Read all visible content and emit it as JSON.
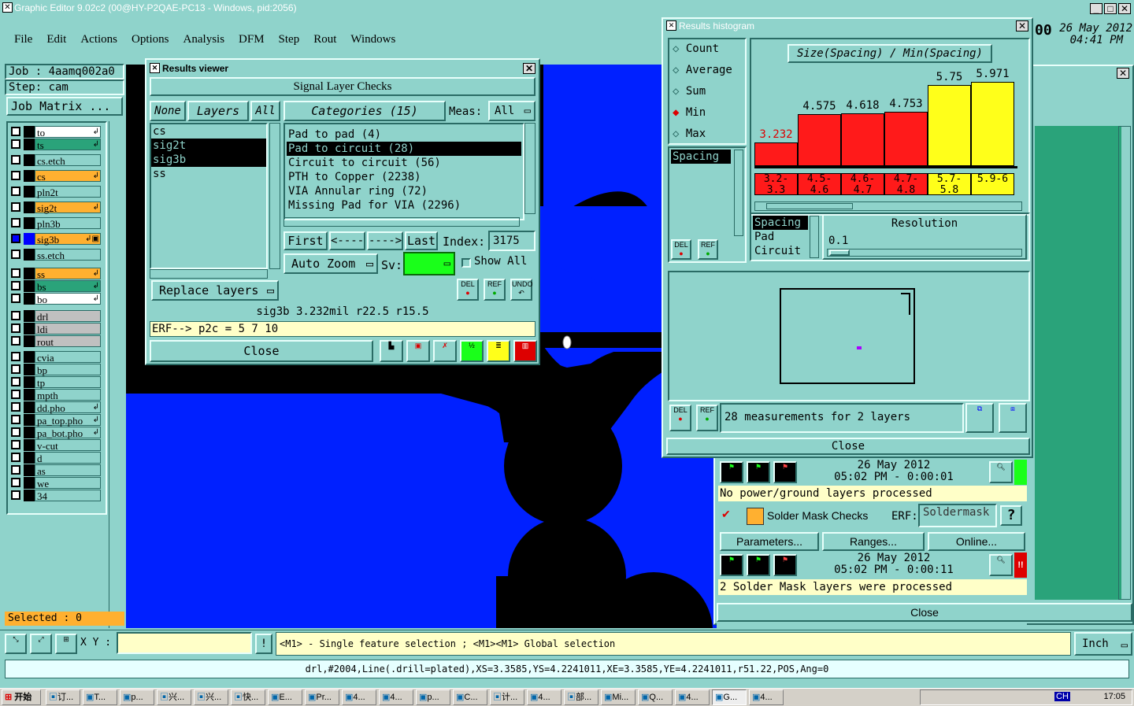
{
  "app": {
    "title": "Graphic Editor 9.02c2 (00@HY-P2QAE-PC13 - Windows, pid:2056)",
    "date": "26 May 2012",
    "time": "04:41 PM",
    "clock_prefix": "00"
  },
  "menu": [
    "File",
    "Edit",
    "Actions",
    "Options",
    "Analysis",
    "DFM",
    "Step",
    "Rout",
    "Windows"
  ],
  "job": {
    "label": "Job : 4aamq002a0",
    "step": "Step: cam",
    "matrix_button": "Job Matrix ..."
  },
  "layers": [
    {
      "name": "to",
      "color": "#ffffff",
      "sym": "↲"
    },
    {
      "name": "ts",
      "color": "#2aa37a",
      "sym": "↲"
    },
    {
      "name": "cs.etch",
      "color": "#8fd3cb",
      "sym": ""
    },
    {
      "name": "cs",
      "color": "#ffb030",
      "sym": "↲"
    },
    {
      "name": "pln2t",
      "color": "#8fd3cb",
      "sym": ""
    },
    {
      "name": "sig2t",
      "color": "#ffb030",
      "sym": "↲"
    },
    {
      "name": "pln3b",
      "color": "#8fd3cb",
      "sym": ""
    },
    {
      "name": "sig3b",
      "color": "#ffb030",
      "sym": "↲▣"
    },
    {
      "name": "ss.etch",
      "color": "#8fd3cb",
      "sym": ""
    },
    {
      "name": "ss",
      "color": "#ffb030",
      "sym": "↲"
    },
    {
      "name": "bs",
      "color": "#2aa37a",
      "sym": "↲"
    },
    {
      "name": "bo",
      "color": "#ffffff",
      "sym": "↲"
    },
    {
      "name": "drl",
      "color": "#c0c0c0",
      "sym": ""
    },
    {
      "name": "ldi",
      "color": "#c0c0c0",
      "sym": ""
    },
    {
      "name": "rout",
      "color": "#c0c0c0",
      "sym": ""
    },
    {
      "name": "cvia",
      "color": "#8fd3cb",
      "sym": ""
    },
    {
      "name": "bp",
      "color": "#8fd3cb",
      "sym": ""
    },
    {
      "name": "tp",
      "color": "#8fd3cb",
      "sym": ""
    },
    {
      "name": "mpth",
      "color": "#8fd3cb",
      "sym": ""
    },
    {
      "name": "dd.pho",
      "color": "#8fd3cb",
      "sym": "↲"
    },
    {
      "name": "pa_top.pho",
      "color": "#8fd3cb",
      "sym": "↲"
    },
    {
      "name": "pa_bot.pho",
      "color": "#8fd3cb",
      "sym": "↲"
    },
    {
      "name": "v-cut",
      "color": "#8fd3cb",
      "sym": ""
    },
    {
      "name": "d",
      "color": "#8fd3cb",
      "sym": ""
    },
    {
      "name": "as",
      "color": "#8fd3cb",
      "sym": ""
    },
    {
      "name": "we",
      "color": "#8fd3cb",
      "sym": ""
    },
    {
      "name": "34",
      "color": "#8fd3cb",
      "sym": ""
    }
  ],
  "selected": "Selected : 0",
  "results_viewer": {
    "title": "Results viewer",
    "header": "Signal Layer Checks",
    "none_btn": "None",
    "layers_btn": "Layers",
    "all_btn": "All",
    "layer_list": [
      "cs",
      "sig2t",
      "sig3b",
      "ss"
    ],
    "categories_btn": "Categories (15)",
    "meas_label": "Meas:",
    "meas_value": "All",
    "categories": [
      "Pad to pad (4)",
      "Pad to circuit (28)",
      "Circuit to circuit (56)",
      "PTH to Copper (2238)",
      "VIA Annular ring (72)",
      "Missing Pad for VIA (2296)"
    ],
    "first": "First",
    "prev": "<----",
    "next": "---->",
    "last": "Last",
    "index_label": "Index:",
    "index_value": "3175",
    "auto_zoom": "Auto Zoom",
    "sv_label": "Sv:",
    "show_all": "Show All",
    "replace_layers": "Replace layers",
    "del": "DEL",
    "ref": "REF",
    "undo": "UNDO",
    "status": "sig3b 3.232mil  r22.5  r15.5",
    "erf": "ERF--> p2c = 5 7 10",
    "close": "Close"
  },
  "histogram": {
    "title": "Results histogram",
    "modes": [
      "Count",
      "Average",
      "Sum",
      "Min",
      "Max"
    ],
    "selected_mode": "Min",
    "chart_title": "Size(Spacing) / Min(Spacing)",
    "measure_list": [
      "Spacing"
    ],
    "value_list": [
      "Spacing",
      "Pad",
      "Circuit"
    ],
    "resolution_label": "Resolution",
    "resolution_value": "0.1",
    "measurements": "28 measurements for 2 layers",
    "close": "Close",
    "del": "DEL",
    "ref": "REF"
  },
  "chart_data": {
    "type": "bar",
    "title": "Size(Spacing) / Min(Spacing)",
    "categories": [
      "3.2-3.3",
      "4.5-4.6",
      "4.6-4.7",
      "4.7-4.8",
      "5.7-5.8",
      "5.9-6"
    ],
    "values": [
      3.232,
      4.575,
      4.618,
      4.753,
      5.75,
      5.971
    ],
    "colors": [
      "#ff1a1a",
      "#ff1a1a",
      "#ff1a1a",
      "#ff1a1a",
      "#ffff1a",
      "#ffff1a"
    ],
    "ylim": [
      0,
      6.2
    ]
  },
  "checks": {
    "power_date": "26 May 2012",
    "power_time": "05:02 PM - 0:00:01",
    "power_msg": "No power/ground layers processed",
    "solder_title": "Solder Mask Checks",
    "erf_label": "ERF:",
    "erf_value": "Soldermask",
    "help": "?",
    "params": "Parameters...",
    "ranges": "Ranges...",
    "online": "Online...",
    "solder_date": "26 May 2012",
    "solder_time": "05:02 PM - 0:00:11",
    "solder_msg": "2 Solder Mask layers were processed",
    "close": "Close",
    "warn": "!!"
  },
  "bottom": {
    "xy_label": "X Y :",
    "xy_value": "",
    "excl": "!",
    "hint": "<M1> - Single feature selection ; <M1><M1> Global selection",
    "unit": "Inch",
    "info": "drl,#2004,Line(.drill=plated),XS=3.3585,YS=4.2241011,XE=3.3585,YE=4.2241011,r51.22,POS,Ang=0"
  },
  "taskbar": {
    "start": "开始",
    "items": [
      "订...",
      "T...",
      "p...",
      "兴...",
      "兴...",
      "快...",
      "E...",
      "Pr...",
      "4...",
      "4...",
      "p...",
      "C...",
      "计...",
      "4...",
      "部...",
      "Mi...",
      "Q...",
      "4...",
      "G...",
      "4..."
    ],
    "clock": "17:05",
    "lang": "CH"
  }
}
